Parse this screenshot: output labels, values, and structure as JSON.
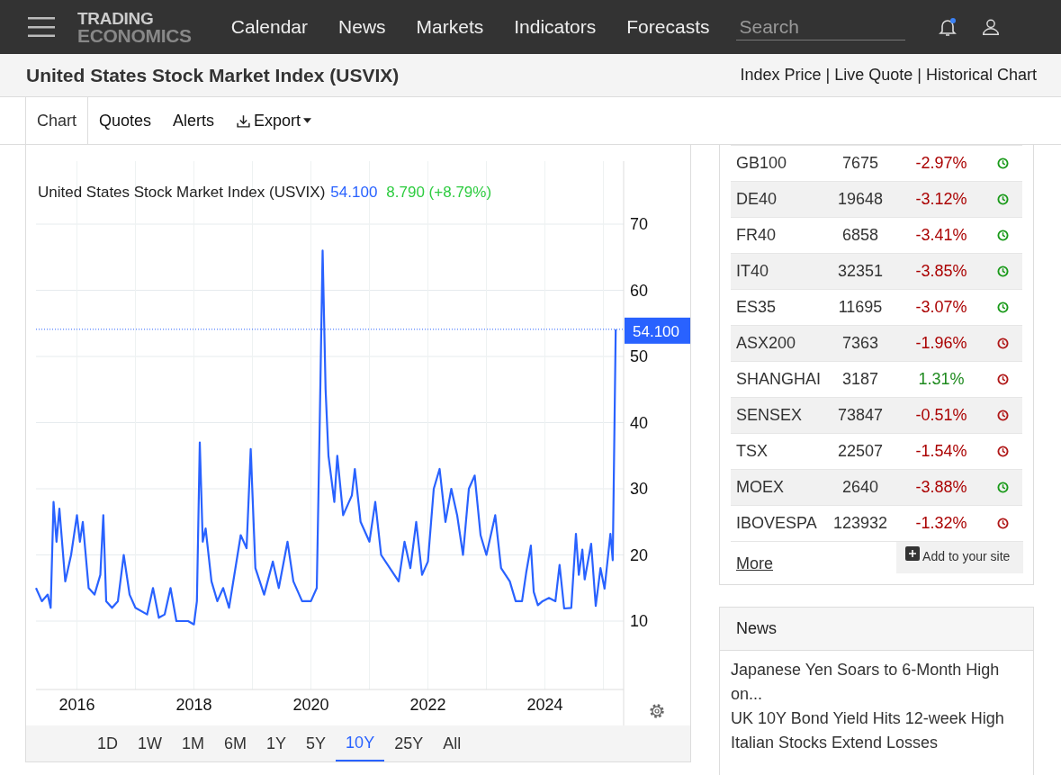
{
  "header": {
    "logo": [
      "TRADING",
      "ECONOMICS"
    ],
    "nav": [
      "Calendar",
      "News",
      "Markets",
      "Indicators",
      "Forecasts"
    ],
    "search": {
      "placeholder": "Search"
    },
    "notifications": {
      "unread": true
    }
  },
  "page": {
    "title": "United States Stock Market Index (USVIX)",
    "links": [
      "Index Price",
      "Live Quote",
      "Historical Chart"
    ],
    "separator": "|"
  },
  "tabs": [
    {
      "label": "Chart",
      "selected": true,
      "kind": "tab"
    },
    {
      "label": "Quotes",
      "selected": false,
      "kind": "tab"
    },
    {
      "label": "Alerts",
      "selected": false,
      "kind": "tab"
    },
    {
      "label": "Export",
      "selected": false,
      "kind": "menu"
    }
  ],
  "chart": {
    "legend": {
      "name": "United States Stock Market Index (USVIX)",
      "value": "54.100",
      "change": "8.790 (+8.79%)"
    },
    "chart_data": {
      "type": "line",
      "grid": true,
      "ref_lines": [
        {
          "axis": "y",
          "value": 54.1,
          "label": "54.100",
          "color": "#2962ff"
        }
      ],
      "xlim": [
        2015.3,
        2025.3
      ],
      "ylim": [
        0,
        80
      ],
      "xticks": [
        2016,
        2018,
        2020,
        2022,
        2024
      ],
      "yticks": [
        10,
        20,
        30,
        40,
        50,
        60,
        70
      ],
      "x": [
        2015.3,
        2015.4,
        2015.5,
        2015.55,
        2015.6,
        2015.65,
        2015.7,
        2015.8,
        2015.9,
        2016.0,
        2016.05,
        2016.1,
        2016.2,
        2016.3,
        2016.4,
        2016.45,
        2016.5,
        2016.6,
        2016.7,
        2016.8,
        2016.9,
        2017.0,
        2017.2,
        2017.3,
        2017.4,
        2017.5,
        2017.6,
        2017.7,
        2017.8,
        2017.9,
        2018.0,
        2018.05,
        2018.1,
        2018.15,
        2018.2,
        2018.3,
        2018.4,
        2018.5,
        2018.6,
        2018.8,
        2018.9,
        2018.97,
        2019.05,
        2019.2,
        2019.35,
        2019.45,
        2019.6,
        2019.7,
        2019.85,
        2020.0,
        2020.1,
        2020.15,
        2020.2,
        2020.25,
        2020.3,
        2020.4,
        2020.45,
        2020.55,
        2020.7,
        2020.75,
        2020.85,
        2021.0,
        2021.1,
        2021.2,
        2021.35,
        2021.5,
        2021.6,
        2021.7,
        2021.8,
        2021.9,
        2022.0,
        2022.1,
        2022.2,
        2022.3,
        2022.4,
        2022.5,
        2022.6,
        2022.7,
        2022.8,
        2022.9,
        2023.0,
        2023.15,
        2023.25,
        2023.4,
        2023.5,
        2023.61,
        2023.68,
        2023.76,
        2023.81,
        2023.88,
        2023.96,
        2024.07,
        2024.18,
        2024.25,
        2024.33,
        2024.45,
        2024.53,
        2024.58,
        2024.64,
        2024.68,
        2024.79,
        2024.87,
        2024.95,
        2025.02,
        2025.12,
        2025.16,
        2025.21
      ],
      "series": [
        {
          "color": "#2962ff",
          "values": [
            15,
            13,
            14,
            12,
            28,
            22,
            27,
            16,
            20,
            26,
            22,
            25,
            15,
            14,
            17,
            26,
            13,
            12,
            13,
            20,
            14,
            12,
            11,
            15,
            10.5,
            11,
            15,
            10,
            10,
            10,
            9.5,
            13,
            37,
            22,
            24,
            16,
            13,
            15,
            12,
            23,
            21,
            36,
            18,
            14,
            19,
            15,
            22,
            16,
            13,
            13,
            15,
            40,
            66,
            45,
            35,
            28,
            35,
            26,
            29,
            33,
            25,
            22,
            28,
            20,
            18,
            16,
            22,
            18,
            25,
            17,
            19,
            30,
            33,
            25,
            30,
            26,
            20,
            30,
            32,
            23,
            20,
            26,
            18,
            16,
            13,
            13,
            17.3,
            21.4,
            14.4,
            12.4,
            13,
            13.5,
            13,
            18.5,
            11.9,
            12,
            23.2,
            17,
            20.8,
            16.3,
            21.7,
            12.3,
            18,
            14.9,
            23.2,
            19.2,
            54.1
          ]
        }
      ]
    }
  },
  "range": [
    {
      "label": "1D",
      "selected": false
    },
    {
      "label": "1W",
      "selected": false
    },
    {
      "label": "1M",
      "selected": false
    },
    {
      "label": "6M",
      "selected": false
    },
    {
      "label": "1Y",
      "selected": false
    },
    {
      "label": "5Y",
      "selected": false
    },
    {
      "label": "10Y",
      "selected": true
    },
    {
      "label": "25Y",
      "selected": false
    },
    {
      "label": "All",
      "selected": false
    }
  ],
  "markets": {
    "rows": [
      {
        "name": "GB100",
        "price": "7675",
        "change": "-2.97%",
        "up": false,
        "open": true
      },
      {
        "name": "DE40",
        "price": "19648",
        "change": "-3.12%",
        "up": false,
        "open": true
      },
      {
        "name": "FR40",
        "price": "6858",
        "change": "-3.41%",
        "up": false,
        "open": true
      },
      {
        "name": "IT40",
        "price": "32351",
        "change": "-3.85%",
        "up": false,
        "open": true
      },
      {
        "name": "ES35",
        "price": "11695",
        "change": "-3.07%",
        "up": false,
        "open": true
      },
      {
        "name": "ASX200",
        "price": "7363",
        "change": "-1.96%",
        "up": false,
        "open": false
      },
      {
        "name": "SHANGHAI",
        "price": "3187",
        "change": "1.31%",
        "up": true,
        "open": false
      },
      {
        "name": "SENSEX",
        "price": "73847",
        "change": "-0.51%",
        "up": false,
        "open": false
      },
      {
        "name": "TSX",
        "price": "22507",
        "change": "-1.54%",
        "up": false,
        "open": false
      },
      {
        "name": "MOEX",
        "price": "2640",
        "change": "-3.88%",
        "up": false,
        "open": true
      },
      {
        "name": "IBOVESPA",
        "price": "123932",
        "change": "-1.32%",
        "up": false,
        "open": false
      }
    ],
    "more": "More",
    "add": "Add to your site"
  },
  "news": {
    "title": "News",
    "items": [
      "Japanese Yen Soars to 6-Month High on...",
      "UK 10Y Bond Yield Hits 12-week High",
      "Italian Stocks Extend Losses"
    ]
  }
}
